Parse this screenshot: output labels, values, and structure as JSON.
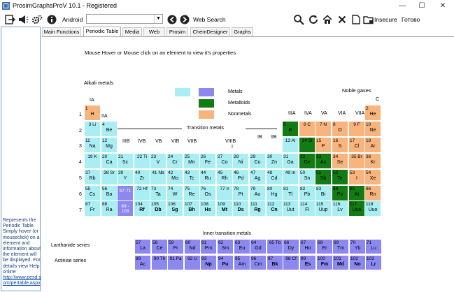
{
  "window": {
    "title": "ProsimGraphsProV 10.1 - Registered",
    "minimize": "—",
    "maximize": "☐",
    "close": "✕"
  },
  "toolbar": {
    "android_label": "Android",
    "combo_value": "",
    "web_search_label": "Web Search",
    "insecure_label": "Insecure",
    "done_label": "Готово"
  },
  "tabs": [
    {
      "label": "Main Functions",
      "active": false
    },
    {
      "label": "Periodic Table",
      "active": true
    },
    {
      "label": "Media",
      "active": false
    },
    {
      "label": "Web",
      "active": false
    },
    {
      "label": "Prosim",
      "active": false
    },
    {
      "label": "ChemDesigner",
      "active": false
    },
    {
      "label": "Graphs",
      "active": false
    }
  ],
  "sidebar": {
    "info_text": "Represents the Periodic Table. Simply hover (or mouseclick) on a element and information about the element will be displayed. For details view Help online",
    "link_text": "http://www.pesd.s om/pertable.aspx"
  },
  "periodic": {
    "hint": "Mouse Hover or Mouse click on an element to view it's properties",
    "group_title": "Alkali metals",
    "noble_title": "Noble gases",
    "transition_title": "Transition metals",
    "inner_title": "Inner transition metals",
    "lanthanide_label": "Lanthanide series",
    "actinide_label": "Actinise series",
    "legend": [
      {
        "label": "Metals"
      },
      {
        "label": "Metalloids"
      },
      {
        "label": "Nonmetals"
      }
    ],
    "group_labels": [
      "IA",
      "IIA",
      "IIIB",
      "IVB",
      "VB",
      "VIB",
      "VIIB",
      "VIIIB",
      "I",
      "IB",
      "IIB",
      "IIIA",
      "IVA",
      "VA",
      "VIA",
      "VIIA",
      "C"
    ],
    "period_labels": [
      "1",
      "2",
      "3",
      "4",
      "5",
      "6",
      "7"
    ],
    "colors": {
      "metal": "#a8eef2",
      "metalloid": "#137b13",
      "nonmetal": "#f7b47d",
      "inner": "#8d87f0"
    }
  },
  "elements": [
    {
      "n": "1",
      "s": "H",
      "c": "nonmetal",
      "col": 0,
      "row": 0
    },
    {
      "n": "2",
      "s": "He",
      "c": "nonmetal",
      "col": 17,
      "row": 0
    },
    {
      "n": "3",
      "s": "Li",
      "c": "metal",
      "col": 0,
      "row": 1,
      "inline": true
    },
    {
      "n": "4",
      "s": "Be",
      "c": "metal",
      "col": 1,
      "row": 1
    },
    {
      "n": "5",
      "s": "B",
      "c": "metalloid",
      "col": 12,
      "row": 1
    },
    {
      "n": "6",
      "s": "C",
      "c": "nonmetal",
      "col": 13,
      "row": 1,
      "inline": true
    },
    {
      "n": "7",
      "s": "N",
      "c": "nonmetal",
      "col": 14,
      "row": 1,
      "inline": true
    },
    {
      "n": "8",
      "s": "O",
      "c": "nonmetal",
      "col": 15,
      "row": 1
    },
    {
      "n": "9",
      "s": "F",
      "c": "nonmetal",
      "col": 16,
      "row": 1,
      "inline": true
    },
    {
      "n": "10",
      "s": "Ne",
      "c": "nonmetal",
      "col": 17,
      "row": 1
    },
    {
      "n": "11",
      "s": "Na",
      "c": "metal",
      "col": 0,
      "row": 2
    },
    {
      "n": "12",
      "s": "Mg",
      "c": "metal",
      "col": 1,
      "row": 2
    },
    {
      "n": "13",
      "s": "Al",
      "c": "metal",
      "col": 12,
      "row": 2,
      "inline": true
    },
    {
      "n": "14",
      "s": "Si",
      "c": "metalloid",
      "col": 13,
      "row": 2,
      "inline": true
    },
    {
      "n": "15",
      "s": "P",
      "c": "nonmetal",
      "col": 14,
      "row": 2
    },
    {
      "n": "16",
      "s": "S",
      "c": "nonmetal",
      "col": 15,
      "row": 2
    },
    {
      "n": "17",
      "s": "Cl",
      "c": "nonmetal",
      "col": 16,
      "row": 2
    },
    {
      "n": "18",
      "s": "Ar",
      "c": "nonmetal",
      "col": 17,
      "row": 2
    },
    {
      "n": "19",
      "s": "K",
      "c": "metal",
      "col": 0,
      "row": 3,
      "inline": true
    },
    {
      "n": "20",
      "s": "Ca",
      "c": "metal",
      "col": 1,
      "row": 3
    },
    {
      "n": "21",
      "s": "Sc",
      "c": "metal",
      "col": 2,
      "row": 3
    },
    {
      "n": "22",
      "s": "Ti",
      "c": "metal",
      "col": 3,
      "row": 3,
      "inline": true
    },
    {
      "n": "23",
      "s": "V",
      "c": "metal",
      "col": 4,
      "row": 3
    },
    {
      "n": "24",
      "s": "Cr",
      "c": "metal",
      "col": 5,
      "row": 3
    },
    {
      "n": "25",
      "s": "Mn",
      "c": "metal",
      "col": 6,
      "row": 3
    },
    {
      "n": "26",
      "s": "Fe",
      "c": "metal",
      "col": 7,
      "row": 3
    },
    {
      "n": "27",
      "s": "Co",
      "c": "metal",
      "col": 8,
      "row": 3
    },
    {
      "n": "28",
      "s": "Ni",
      "c": "metal",
      "col": 9,
      "row": 3
    },
    {
      "n": "29",
      "s": "Cu",
      "c": "metal",
      "col": 10,
      "row": 3
    },
    {
      "n": "30",
      "s": "Zn",
      "c": "metal",
      "col": 11,
      "row": 3
    },
    {
      "n": "31",
      "s": "Ga",
      "c": "metal",
      "col": 12,
      "row": 3
    },
    {
      "n": "32",
      "s": "Ge",
      "c": "metalloid",
      "col": 13,
      "row": 3
    },
    {
      "n": "33",
      "s": "As",
      "c": "metalloid",
      "col": 14,
      "row": 3
    },
    {
      "n": "34",
      "s": "Se",
      "c": "nonmetal",
      "col": 15,
      "row": 3
    },
    {
      "n": "35",
      "s": "Br",
      "c": "nonmetal",
      "col": 16,
      "row": 3,
      "inline": true
    },
    {
      "n": "36",
      "s": "Kr",
      "c": "nonmetal",
      "col": 17,
      "row": 3
    },
    {
      "n": "37",
      "s": "Rb",
      "c": "metal",
      "col": 0,
      "row": 4
    },
    {
      "n": "38",
      "s": "Sr",
      "c": "metal",
      "col": 1,
      "row": 4,
      "inline": true
    },
    {
      "n": "39",
      "s": "Y",
      "c": "metal",
      "col": 2,
      "row": 4
    },
    {
      "n": "40",
      "s": "Zr",
      "c": "metal",
      "col": 3,
      "row": 4
    },
    {
      "n": "41",
      "s": "Nb",
      "c": "metal",
      "col": 4,
      "row": 4,
      "inline": true
    },
    {
      "n": "42",
      "s": "Mo",
      "c": "metal",
      "col": 5,
      "row": 4
    },
    {
      "n": "43",
      "s": "Tc",
      "c": "metal",
      "col": 6,
      "row": 4
    },
    {
      "n": "44",
      "s": "Ru",
      "c": "metal",
      "col": 7,
      "row": 4
    },
    {
      "n": "45",
      "s": "Rh",
      "c": "metal",
      "col": 8,
      "row": 4
    },
    {
      "n": "46",
      "s": "Pd",
      "c": "metal",
      "col": 9,
      "row": 4
    },
    {
      "n": "47",
      "s": "Ag",
      "c": "metal",
      "col": 10,
      "row": 4
    },
    {
      "n": "48",
      "s": "Cd",
      "c": "metal",
      "col": 11,
      "row": 4
    },
    {
      "n": "49",
      "s": "In",
      "c": "metal",
      "col": 12,
      "row": 4,
      "inline": true
    },
    {
      "n": "50",
      "s": "Sn",
      "c": "metal",
      "col": 13,
      "row": 4
    },
    {
      "n": "51",
      "s": "Sb",
      "c": "metalloid",
      "col": 14,
      "row": 4
    },
    {
      "n": "52",
      "s": "Te",
      "c": "metalloid",
      "col": 15,
      "row": 4
    },
    {
      "n": "53",
      "s": "I",
      "c": "nonmetal",
      "col": 16,
      "row": 4
    },
    {
      "n": "54",
      "s": "Xe",
      "c": "nonmetal",
      "col": 17,
      "row": 4
    },
    {
      "n": "55",
      "s": "Cs",
      "c": "metal",
      "col": 0,
      "row": 5
    },
    {
      "n": "56",
      "s": "Ba",
      "c": "metal",
      "col": 1,
      "row": 5
    },
    {
      "n": "57-71",
      "s": "",
      "c": "purple",
      "col": 2,
      "row": 5
    },
    {
      "n": "72",
      "s": "Hf",
      "c": "metal",
      "col": 3,
      "row": 5,
      "inline": true
    },
    {
      "n": "73",
      "s": "Ta",
      "c": "metal",
      "col": 4,
      "row": 5
    },
    {
      "n": "74",
      "s": "W",
      "c": "metal",
      "col": 5,
      "row": 5
    },
    {
      "n": "75",
      "s": "Re",
      "c": "metal",
      "col": 6,
      "row": 5
    },
    {
      "n": "76",
      "s": "Os",
      "c": "metal",
      "col": 7,
      "row": 5
    },
    {
      "n": "77",
      "s": "Ir",
      "c": "metal",
      "col": 8,
      "row": 5,
      "inline": true
    },
    {
      "n": "78",
      "s": "Pt",
      "c": "metal",
      "col": 9,
      "row": 5
    },
    {
      "n": "79",
      "s": "Au",
      "c": "metal",
      "col": 10,
      "row": 5
    },
    {
      "n": "80",
      "s": "Hg",
      "c": "metal",
      "col": 11,
      "row": 5
    },
    {
      "n": "81",
      "s": "Tl",
      "c": "metal",
      "col": 12,
      "row": 5
    },
    {
      "n": "82",
      "s": "Pb",
      "c": "metal",
      "col": 13,
      "row": 5
    },
    {
      "n": "83",
      "s": "Bi",
      "c": "metal",
      "col": 14,
      "row": 5
    },
    {
      "n": "84",
      "s": "Po",
      "c": "metalloid",
      "col": 15,
      "row": 5
    },
    {
      "n": "85",
      "s": "At",
      "c": "metalloid",
      "col": 16,
      "row": 5
    },
    {
      "n": "86",
      "s": "Rn",
      "c": "nonmetal",
      "col": 17,
      "row": 5
    },
    {
      "n": "87",
      "s": "Fr",
      "c": "metal",
      "col": 0,
      "row": 6
    },
    {
      "n": "88",
      "s": "Ra",
      "c": "metal",
      "col": 1,
      "row": 6
    },
    {
      "n": "89 - 103",
      "s": "",
      "c": "purple",
      "col": 2,
      "row": 6
    },
    {
      "n": "104",
      "s": "Rf",
      "c": "metal",
      "col": 3,
      "row": 6,
      "bold": true
    },
    {
      "n": "105",
      "s": "Db",
      "c": "metal",
      "col": 4,
      "row": 6,
      "bold": true
    },
    {
      "n": "106",
      "s": "Sg",
      "c": "metal",
      "col": 5,
      "row": 6,
      "bold": true
    },
    {
      "n": "107",
      "s": "Bh",
      "c": "metal",
      "col": 6,
      "row": 6,
      "bold": true
    },
    {
      "n": "108",
      "s": "Hs",
      "c": "metal",
      "col": 7,
      "row": 6,
      "bold": true
    },
    {
      "n": "109",
      "s": "Mt",
      "c": "metal",
      "col": 8,
      "row": 6,
      "bold": true
    },
    {
      "n": "110",
      "s": "Ds",
      "c": "metal",
      "col": 9,
      "row": 6,
      "bold": true
    },
    {
      "n": "111",
      "s": "Rg",
      "c": "metal",
      "col": 10,
      "row": 6,
      "bold": true
    },
    {
      "n": "112",
      "s": "Cn",
      "c": "metal",
      "col": 11,
      "row": 6,
      "bold": true
    },
    {
      "n": "113",
      "s": "Uut",
      "c": "metal",
      "col": 12,
      "row": 6
    },
    {
      "n": "114",
      "s": "Fl",
      "c": "metal",
      "col": 13,
      "row": 6
    },
    {
      "n": "115",
      "s": "Uup",
      "c": "metal",
      "col": 14,
      "row": 6
    },
    {
      "n": "116",
      "s": "Lv",
      "c": "metal",
      "col": 15,
      "row": 6
    },
    {
      "n": "117",
      "s": "Uus",
      "c": "metalloid",
      "col": 16,
      "row": 6
    },
    {
      "n": "118",
      "s": "Uuo",
      "c": "metal",
      "col": 17,
      "row": 6
    }
  ],
  "lanthanides": [
    {
      "n": "57",
      "s": "La"
    },
    {
      "n": "58",
      "s": "Ce"
    },
    {
      "n": "59",
      "s": "Pr"
    },
    {
      "n": "60",
      "s": "Nd"
    },
    {
      "n": "61",
      "s": "Pm"
    },
    {
      "n": "62",
      "s": "Sm"
    },
    {
      "n": "63",
      "s": "Eu"
    },
    {
      "n": "64",
      "s": "Gd"
    },
    {
      "n": "65",
      "s": "Tb",
      "inline": true
    },
    {
      "n": "66",
      "s": "Dy"
    },
    {
      "n": "67",
      "s": "Ho"
    },
    {
      "n": "68",
      "s": "Er"
    },
    {
      "n": "69",
      "s": "Tm"
    },
    {
      "n": "70",
      "s": "Yb"
    },
    {
      "n": "71",
      "s": "Lu"
    }
  ],
  "actinides": [
    {
      "n": "89",
      "s": "Ac"
    },
    {
      "n": "90",
      "s": "Th",
      "inline": true
    },
    {
      "n": "91",
      "s": "Pa",
      "inline": true
    },
    {
      "n": "92",
      "s": "U",
      "inline": true
    },
    {
      "n": "93",
      "s": "Np",
      "bold": true
    },
    {
      "n": "94",
      "s": "Pu",
      "bold": true
    },
    {
      "n": "95",
      "s": "Am"
    },
    {
      "n": "96",
      "s": "Cm"
    },
    {
      "n": "97",
      "s": "Bk",
      "bold": true
    },
    {
      "n": "98",
      "s": "Cf",
      "inline": true
    },
    {
      "n": "99",
      "s": "Es",
      "bold": true
    },
    {
      "n": "100",
      "s": "Fm",
      "bold": true
    },
    {
      "n": "101",
      "s": "Md",
      "bold": true
    },
    {
      "n": "102",
      "s": "No",
      "bold": true
    },
    {
      "n": "103",
      "s": "Lr",
      "bold": true
    }
  ]
}
